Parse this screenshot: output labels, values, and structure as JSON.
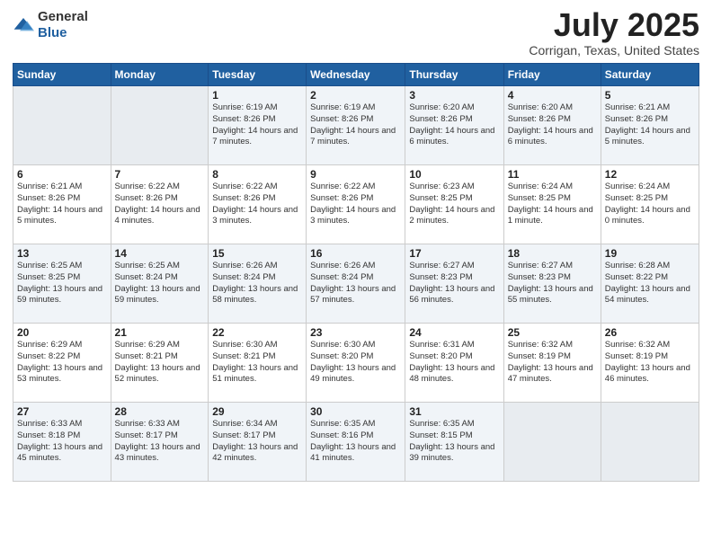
{
  "logo": {
    "general": "General",
    "blue": "Blue"
  },
  "title": "July 2025",
  "location": "Corrigan, Texas, United States",
  "days_of_week": [
    "Sunday",
    "Monday",
    "Tuesday",
    "Wednesday",
    "Thursday",
    "Friday",
    "Saturday"
  ],
  "weeks": [
    [
      {
        "day": "",
        "info": ""
      },
      {
        "day": "",
        "info": ""
      },
      {
        "day": "1",
        "info": "Sunrise: 6:19 AM\nSunset: 8:26 PM\nDaylight: 14 hours and 7 minutes."
      },
      {
        "day": "2",
        "info": "Sunrise: 6:19 AM\nSunset: 8:26 PM\nDaylight: 14 hours and 7 minutes."
      },
      {
        "day": "3",
        "info": "Sunrise: 6:20 AM\nSunset: 8:26 PM\nDaylight: 14 hours and 6 minutes."
      },
      {
        "day": "4",
        "info": "Sunrise: 6:20 AM\nSunset: 8:26 PM\nDaylight: 14 hours and 6 minutes."
      },
      {
        "day": "5",
        "info": "Sunrise: 6:21 AM\nSunset: 8:26 PM\nDaylight: 14 hours and 5 minutes."
      }
    ],
    [
      {
        "day": "6",
        "info": "Sunrise: 6:21 AM\nSunset: 8:26 PM\nDaylight: 14 hours and 5 minutes."
      },
      {
        "day": "7",
        "info": "Sunrise: 6:22 AM\nSunset: 8:26 PM\nDaylight: 14 hours and 4 minutes."
      },
      {
        "day": "8",
        "info": "Sunrise: 6:22 AM\nSunset: 8:26 PM\nDaylight: 14 hours and 3 minutes."
      },
      {
        "day": "9",
        "info": "Sunrise: 6:22 AM\nSunset: 8:26 PM\nDaylight: 14 hours and 3 minutes."
      },
      {
        "day": "10",
        "info": "Sunrise: 6:23 AM\nSunset: 8:25 PM\nDaylight: 14 hours and 2 minutes."
      },
      {
        "day": "11",
        "info": "Sunrise: 6:24 AM\nSunset: 8:25 PM\nDaylight: 14 hours and 1 minute."
      },
      {
        "day": "12",
        "info": "Sunrise: 6:24 AM\nSunset: 8:25 PM\nDaylight: 14 hours and 0 minutes."
      }
    ],
    [
      {
        "day": "13",
        "info": "Sunrise: 6:25 AM\nSunset: 8:25 PM\nDaylight: 13 hours and 59 minutes."
      },
      {
        "day": "14",
        "info": "Sunrise: 6:25 AM\nSunset: 8:24 PM\nDaylight: 13 hours and 59 minutes."
      },
      {
        "day": "15",
        "info": "Sunrise: 6:26 AM\nSunset: 8:24 PM\nDaylight: 13 hours and 58 minutes."
      },
      {
        "day": "16",
        "info": "Sunrise: 6:26 AM\nSunset: 8:24 PM\nDaylight: 13 hours and 57 minutes."
      },
      {
        "day": "17",
        "info": "Sunrise: 6:27 AM\nSunset: 8:23 PM\nDaylight: 13 hours and 56 minutes."
      },
      {
        "day": "18",
        "info": "Sunrise: 6:27 AM\nSunset: 8:23 PM\nDaylight: 13 hours and 55 minutes."
      },
      {
        "day": "19",
        "info": "Sunrise: 6:28 AM\nSunset: 8:22 PM\nDaylight: 13 hours and 54 minutes."
      }
    ],
    [
      {
        "day": "20",
        "info": "Sunrise: 6:29 AM\nSunset: 8:22 PM\nDaylight: 13 hours and 53 minutes."
      },
      {
        "day": "21",
        "info": "Sunrise: 6:29 AM\nSunset: 8:21 PM\nDaylight: 13 hours and 52 minutes."
      },
      {
        "day": "22",
        "info": "Sunrise: 6:30 AM\nSunset: 8:21 PM\nDaylight: 13 hours and 51 minutes."
      },
      {
        "day": "23",
        "info": "Sunrise: 6:30 AM\nSunset: 8:20 PM\nDaylight: 13 hours and 49 minutes."
      },
      {
        "day": "24",
        "info": "Sunrise: 6:31 AM\nSunset: 8:20 PM\nDaylight: 13 hours and 48 minutes."
      },
      {
        "day": "25",
        "info": "Sunrise: 6:32 AM\nSunset: 8:19 PM\nDaylight: 13 hours and 47 minutes."
      },
      {
        "day": "26",
        "info": "Sunrise: 6:32 AM\nSunset: 8:19 PM\nDaylight: 13 hours and 46 minutes."
      }
    ],
    [
      {
        "day": "27",
        "info": "Sunrise: 6:33 AM\nSunset: 8:18 PM\nDaylight: 13 hours and 45 minutes."
      },
      {
        "day": "28",
        "info": "Sunrise: 6:33 AM\nSunset: 8:17 PM\nDaylight: 13 hours and 43 minutes."
      },
      {
        "day": "29",
        "info": "Sunrise: 6:34 AM\nSunset: 8:17 PM\nDaylight: 13 hours and 42 minutes."
      },
      {
        "day": "30",
        "info": "Sunrise: 6:35 AM\nSunset: 8:16 PM\nDaylight: 13 hours and 41 minutes."
      },
      {
        "day": "31",
        "info": "Sunrise: 6:35 AM\nSunset: 8:15 PM\nDaylight: 13 hours and 39 minutes."
      },
      {
        "day": "",
        "info": ""
      },
      {
        "day": "",
        "info": ""
      }
    ]
  ]
}
